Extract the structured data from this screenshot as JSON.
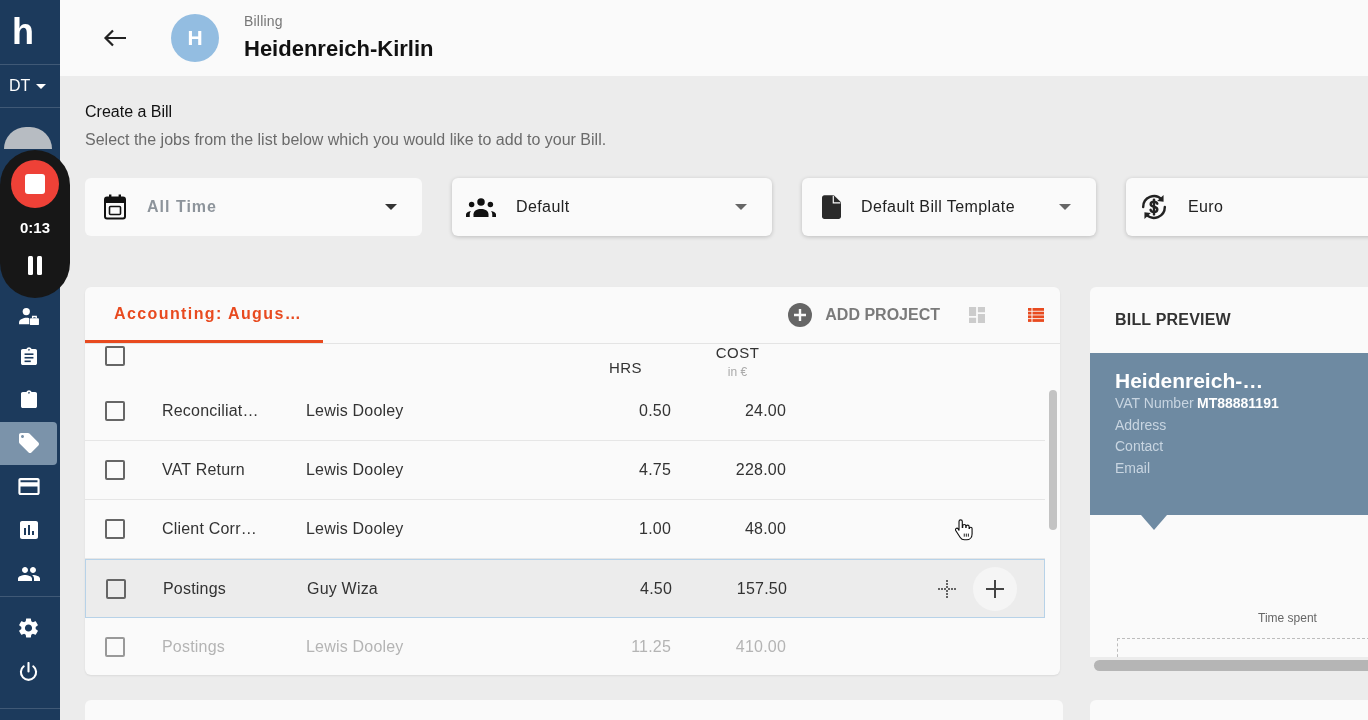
{
  "sidebar": {
    "logo": "h",
    "workspace": "DT",
    "nav_items": [
      {
        "selected": false
      },
      {
        "selected": false
      },
      {
        "selected": false
      },
      {
        "selected": true
      },
      {
        "selected": false
      },
      {
        "selected": false
      },
      {
        "selected": false
      }
    ],
    "footer_items": [
      {
        "selected": false
      },
      {
        "selected": false
      }
    ]
  },
  "recorder": {
    "time": "0:13"
  },
  "header": {
    "avatar_letter": "H",
    "section": "Billing",
    "title": "Heidenreich-Kirlin"
  },
  "intro": {
    "title": "Create a Bill",
    "text": "Select the jobs from the list below which you would like to add to your Bill."
  },
  "filters": [
    {
      "kind": "date",
      "value": "All Time",
      "disabled": true,
      "dropdown": true
    },
    {
      "kind": "team",
      "value": "Default",
      "disabled": false,
      "dropdown": true
    },
    {
      "kind": "template",
      "value": "Default Bill Template",
      "disabled": false,
      "dropdown": true
    },
    {
      "kind": "currency",
      "value": "Euro",
      "disabled": false,
      "dropdown": false
    }
  ],
  "jobs_panel": {
    "tabs": [
      {
        "label": "Accounting: Augus…",
        "selected": true
      }
    ],
    "add_button": "ADD PROJECT",
    "views": [
      {
        "kind": "grid",
        "selected": false
      },
      {
        "kind": "list",
        "selected": true
      }
    ],
    "select_all_checked": false,
    "columns": {
      "hours": "HRS",
      "cost": "COST",
      "cost_unit": "in €"
    },
    "rows": [
      {
        "job": "Reconciliat…",
        "user": "Lewis Dooley",
        "hours": "0.50",
        "cost": "24.00",
        "checked": false,
        "hovered": false,
        "faded": false
      },
      {
        "job": "VAT Return",
        "user": "Lewis Dooley",
        "hours": "4.75",
        "cost": "228.00",
        "checked": false,
        "hovered": false,
        "faded": false
      },
      {
        "job": "Client Corr…",
        "user": "Lewis Dooley",
        "hours": "1.00",
        "cost": "48.00",
        "checked": false,
        "hovered": false,
        "faded": false
      },
      {
        "job": "Postings",
        "user": "Guy Wiza",
        "hours": "4.50",
        "cost": "157.50",
        "checked": false,
        "hovered": true,
        "faded": false
      },
      {
        "job": "Postings",
        "user": "Lewis Dooley",
        "hours": "11.25",
        "cost": "410.00",
        "checked": false,
        "hovered": false,
        "faded": true
      }
    ]
  },
  "preview": {
    "title": "BILL PREVIEW",
    "client": "Heidenreich-…",
    "fields": [
      {
        "label": "VAT Number",
        "value": "MT88881191"
      },
      {
        "label": "Address"
      },
      {
        "label": "Contact"
      },
      {
        "label": "Email"
      }
    ],
    "chart_title": "Time spent"
  }
}
